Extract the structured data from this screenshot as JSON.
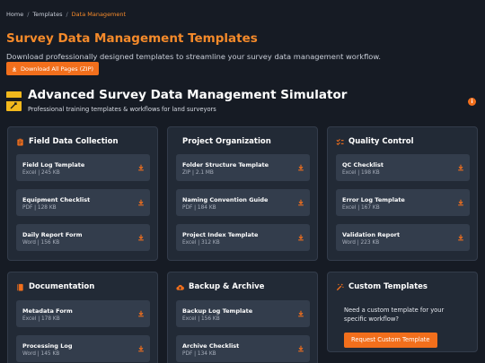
{
  "breadcrumb": {
    "home": "Home",
    "templates": "Templates",
    "current": "Data Management",
    "separator": "/"
  },
  "page": {
    "title": "Survey Data Management Templates",
    "subtitle": "Download professionally designed templates to streamline your survey data management workflow.",
    "download_all_label": "Download All Pages (ZIP)"
  },
  "simulator": {
    "title": "Advanced Survey Data Management Simulator",
    "subtitle": "Professional training templates & workflows for land surveyors",
    "info_glyph": "i"
  },
  "colors": {
    "accent": "#f26f1c",
    "title_orange": "#f58a2a",
    "background": "#161b24",
    "card": "#222a36",
    "item": "#333d4c"
  },
  "cards": {
    "field": {
      "title": "Field Data Collection",
      "icon": "clipboard-icon",
      "items": [
        {
          "name": "Field Log Template",
          "meta": "Excel | 245 KB"
        },
        {
          "name": "Equipment Checklist",
          "meta": "PDF | 128 KB"
        },
        {
          "name": "Daily Report Form",
          "meta": "Word | 156 KB"
        }
      ]
    },
    "project": {
      "title": "Project Organization",
      "items": [
        {
          "name": "Folder Structure Template",
          "meta": "ZIP | 2.1 MB"
        },
        {
          "name": "Naming Convention Guide",
          "meta": "PDF | 184 KB"
        },
        {
          "name": "Project Index Template",
          "meta": "Excel | 312 KB"
        }
      ]
    },
    "quality": {
      "title": "Quality Control",
      "icon": "check-list-icon",
      "items": [
        {
          "name": "QC Checklist",
          "meta": "Excel | 198 KB"
        },
        {
          "name": "Error Log Template",
          "meta": "Excel | 167 KB"
        },
        {
          "name": "Validation Report",
          "meta": "Word | 223 KB"
        }
      ]
    },
    "documentation": {
      "title": "Documentation",
      "icon": "book-icon",
      "items": [
        {
          "name": "Metadata Form",
          "meta": "Excel | 178 KB"
        },
        {
          "name": "Processing Log",
          "meta": "Word | 145 KB"
        }
      ]
    },
    "backup": {
      "title": "Backup & Archive",
      "icon": "cloud-upload-icon",
      "items": [
        {
          "name": "Backup Log Template",
          "meta": "Excel | 156 KB"
        },
        {
          "name": "Archive Checklist",
          "meta": "PDF | 134 KB"
        }
      ]
    },
    "custom": {
      "title": "Custom Templates",
      "icon": "magic-wand-icon",
      "text": "Need a custom template for your specific workflow?",
      "button_label": "Request Custom Template"
    }
  }
}
